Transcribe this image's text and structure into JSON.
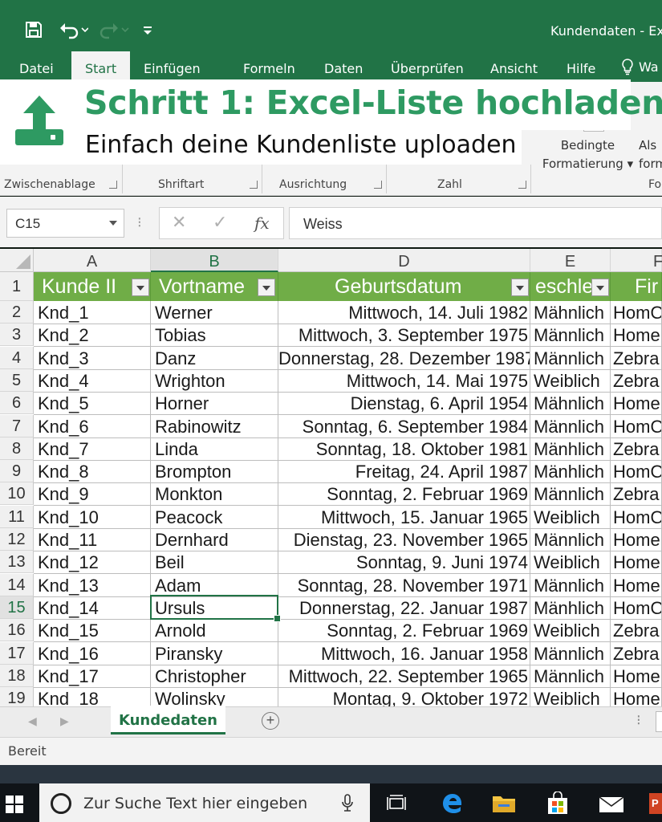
{
  "window": {
    "title": "Kundendaten - Ex"
  },
  "ribbon": {
    "tabs": [
      "Datei",
      "Start",
      "Einfügen",
      "Formeln",
      "Daten",
      "Überprüfen",
      "Ansicht",
      "Hilfe",
      "Wa"
    ],
    "groups": [
      "Zwischenablage",
      "Shriftart",
      "Ausrichtung",
      "Zahl",
      "Fo"
    ],
    "cond_format_line1": "Bedingte",
    "cond_format_line2": "Formatierung ▾",
    "table_format_line1": "Als",
    "table_format_line2": "form"
  },
  "banner": {
    "title": "Schritt 1: Excel-Liste hochladen",
    "subtitle": "Einfach deine Kundenliste uploaden",
    "color": "#2e9a62"
  },
  "formula": {
    "namebox": "C15",
    "value": "Weiss",
    "fx": "fx"
  },
  "columns": [
    "A",
    "B",
    "D",
    "E",
    "F"
  ],
  "headers": [
    "Kunde II",
    "Vortname",
    "Geburtsdatum",
    "eschle",
    "Fir"
  ],
  "row_numbers": [
    "1",
    "2",
    "3",
    "4",
    "5",
    "6",
    "7",
    "8",
    "9",
    "10",
    "11",
    "12",
    "13",
    "14",
    "15",
    "16",
    "17",
    "18",
    "19"
  ],
  "rows": [
    [
      "Knd_1",
      "Werner",
      "Mittwoch, 14. Juli 1982",
      "Mähnlich",
      "HomO"
    ],
    [
      "Knd_2",
      "Tobias",
      "Mittwoch, 3. September 1975",
      "Männlich",
      "Home"
    ],
    [
      "Knd_3",
      "Danz",
      "Donnerstag, 28. Dezember 1987",
      "Männlich",
      "Zebra"
    ],
    [
      "Knd_4",
      "Wrighton",
      "Mittwoch, 14. Mai 1975",
      "Weiblich",
      "Zebra"
    ],
    [
      "Knd_5",
      "Horner",
      "Dienstag, 6. April 1954",
      "Mähnlich",
      "Home"
    ],
    [
      "Knd_6",
      "Rabinowitz",
      "Sonntag, 6. September 1984",
      "Männlich",
      "HomO"
    ],
    [
      "Knd_7",
      "Linda",
      "Sonntag, 18. Oktober 1981",
      "Mänhlich",
      "Zebra"
    ],
    [
      "Knd_8",
      "Brompton",
      "Freitag, 24. April 1987",
      "Mänhlich",
      "HomO"
    ],
    [
      "Knd_9",
      "Monkton",
      "Sonntag, 2. Februar 1969",
      "Männlich",
      "Zebra"
    ],
    [
      "Knd_10",
      "Peacock",
      "Mittwoch, 15. Januar 1965",
      "Weiblich",
      "HomO"
    ],
    [
      "Knd_11",
      "Dernhard",
      "Dienstag, 23. November 1965",
      "Männlich",
      "Home"
    ],
    [
      "Knd_12",
      "Beil",
      "Sonntag, 9. Juni 1974",
      "Weiblich",
      "Home"
    ],
    [
      "Knd_13",
      "Adam",
      "Sonntag, 28. November 1971",
      "Männlich",
      "Home"
    ],
    [
      "Knd_14",
      "Ursuls",
      "Donnerstag, 22. Januar 1987",
      "Mänhlich",
      "HomO"
    ],
    [
      "Knd_15",
      "Arnold",
      "Sonntag, 2. Februar 1969",
      "Weiblich",
      "Zebra"
    ],
    [
      "Knd_16",
      "Piransky",
      "Mittwoch, 16. Januar 1958",
      "Männlich",
      "Zebra"
    ],
    [
      "Knd_17",
      "Christopher",
      "Mittwoch, 22. September 1965",
      "Männlich",
      "Home"
    ],
    [
      "Knd_18",
      "Wolinsky",
      "Montag, 9. Oktober 1972",
      "Weiblich",
      "Home"
    ]
  ],
  "sheet": {
    "tab": "Kundedaten"
  },
  "status": {
    "text": "Bereit"
  },
  "taskbar": {
    "search_placeholder": "Zur Suche Text hier eingeben"
  },
  "colors": {
    "excel_green": "#217346",
    "header_green": "#70ad47"
  }
}
